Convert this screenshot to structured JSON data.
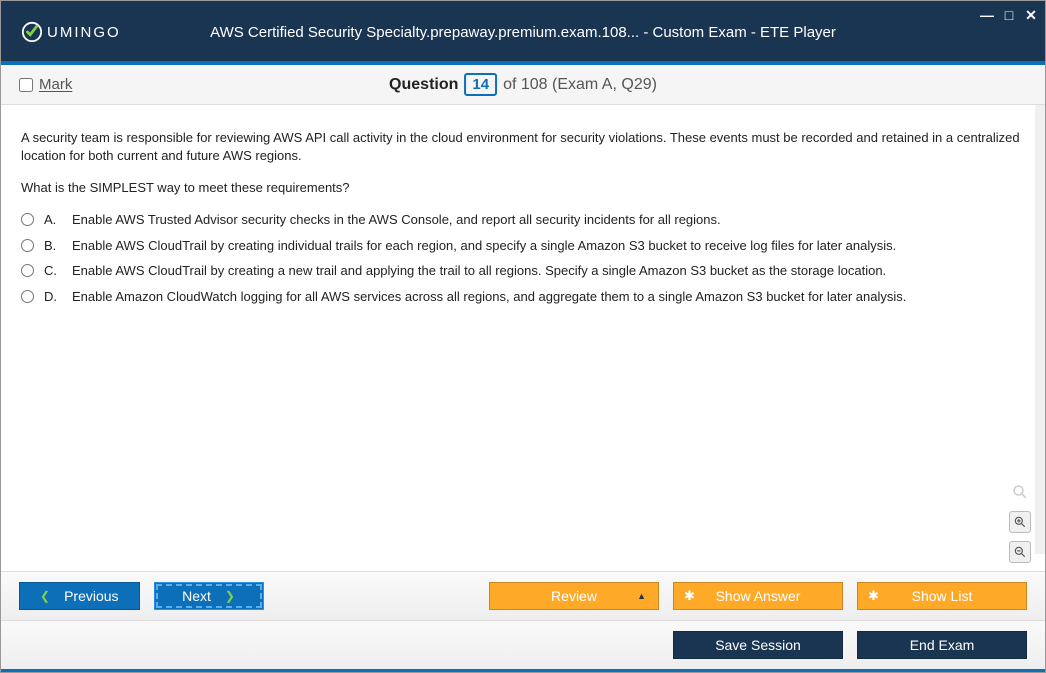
{
  "window": {
    "title": "AWS Certified Security Specialty.prepaway.premium.exam.108... - Custom Exam - ETE Player",
    "logo_text": "UMINGO"
  },
  "header": {
    "mark_label": "Mark",
    "question_label": "Question",
    "question_number": "14",
    "of_text": "of 108 (Exam A, Q29)"
  },
  "question": {
    "text1": "A security team is responsible for reviewing AWS API call activity in the cloud environment for security violations. These events must be recorded and retained in a centralized location for both current and future AWS regions.",
    "text2": "What is the SIMPLEST way to meet these requirements?",
    "options": [
      {
        "letter": "A.",
        "text": "Enable AWS Trusted Advisor security checks in the AWS Console, and report all security incidents for all regions."
      },
      {
        "letter": "B.",
        "text": "Enable AWS CloudTrail by creating individual trails for each region, and specify a single Amazon S3 bucket to receive log files for later analysis."
      },
      {
        "letter": "C.",
        "text": "Enable AWS CloudTrail by creating a new trail and applying the trail to all regions. Specify a single Amazon S3 bucket as the storage location."
      },
      {
        "letter": "D.",
        "text": "Enable Amazon CloudWatch logging for all AWS services across all regions, and aggregate them to a single Amazon S3 bucket for later analysis."
      }
    ]
  },
  "footer": {
    "previous": "Previous",
    "next": "Next",
    "review": "Review",
    "show_answer": "Show Answer",
    "show_list": "Show List",
    "save_session": "Save Session",
    "end_exam": "End Exam"
  }
}
